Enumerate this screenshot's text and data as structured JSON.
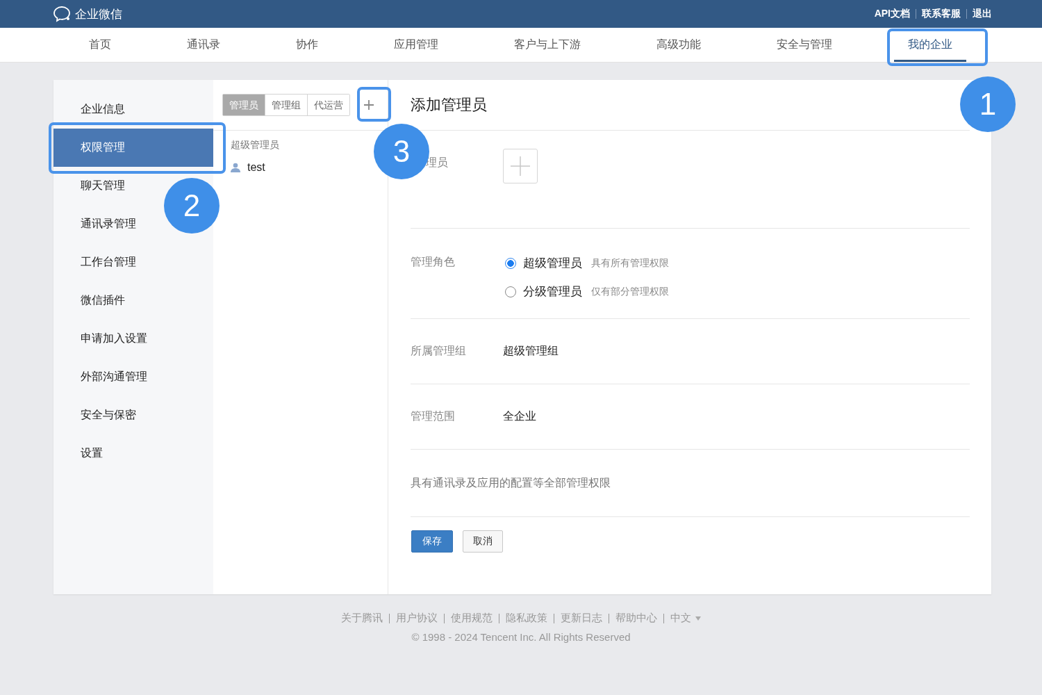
{
  "header": {
    "logo": "企业微信",
    "links": [
      "API文档",
      "联系客服",
      "退出"
    ]
  },
  "nav": [
    {
      "label": "首页",
      "selected": false
    },
    {
      "label": "通讯录",
      "selected": false
    },
    {
      "label": "协作",
      "selected": false
    },
    {
      "label": "应用管理",
      "selected": false
    },
    {
      "label": "客户与上下游",
      "selected": false
    },
    {
      "label": "高级功能",
      "selected": false
    },
    {
      "label": "安全与管理",
      "selected": false
    },
    {
      "label": "我的企业",
      "selected": true
    }
  ],
  "sidebar": {
    "items": [
      {
        "label": "企业信息",
        "selected": false
      },
      {
        "label": "权限管理",
        "selected": true
      },
      {
        "label": "聊天管理",
        "selected": false
      },
      {
        "label": "通讯录管理",
        "selected": false
      },
      {
        "label": "工作台管理",
        "selected": false
      },
      {
        "label": "微信插件",
        "selected": false
      },
      {
        "label": "申请加入设置",
        "selected": false
      },
      {
        "label": "外部沟通管理",
        "selected": false
      },
      {
        "label": "安全与保密",
        "selected": false
      },
      {
        "label": "设置",
        "selected": false
      }
    ]
  },
  "admin_panel": {
    "tabs": [
      {
        "label": "管理员",
        "selected": true
      },
      {
        "label": "管理组",
        "selected": false
      },
      {
        "label": "代运营",
        "selected": false
      }
    ],
    "groups": [
      {
        "title": "超级管理员",
        "members": [
          "test"
        ]
      }
    ]
  },
  "form": {
    "title": "添加管理员",
    "admin_label": "理员",
    "role_label": "管理角色",
    "roles": [
      {
        "name": "超级管理员",
        "desc": "具有所有管理权限",
        "selected": true
      },
      {
        "name": "分级管理员",
        "desc": "仅有部分管理权限",
        "selected": false
      }
    ],
    "group_label": "所属管理组",
    "group_value": "超级管理组",
    "scope_label": "管理范围",
    "scope_value": "全企业",
    "description": "具有通讯录及应用的配置等全部管理权限",
    "buttons": [
      {
        "label": "保存",
        "kind": "primary"
      },
      {
        "label": "取消",
        "kind": "secondary"
      }
    ]
  },
  "footer": {
    "links": [
      "关于腾讯",
      "用户协议",
      "使用规范",
      "隐私政策",
      "更新日志",
      "帮助中心"
    ],
    "language": "中文",
    "copyright": "© 1998 - 2024 Tencent Inc. All Rights Reserved"
  },
  "annotations": [
    {
      "number": "1"
    },
    {
      "number": "2"
    },
    {
      "number": "3"
    }
  ]
}
